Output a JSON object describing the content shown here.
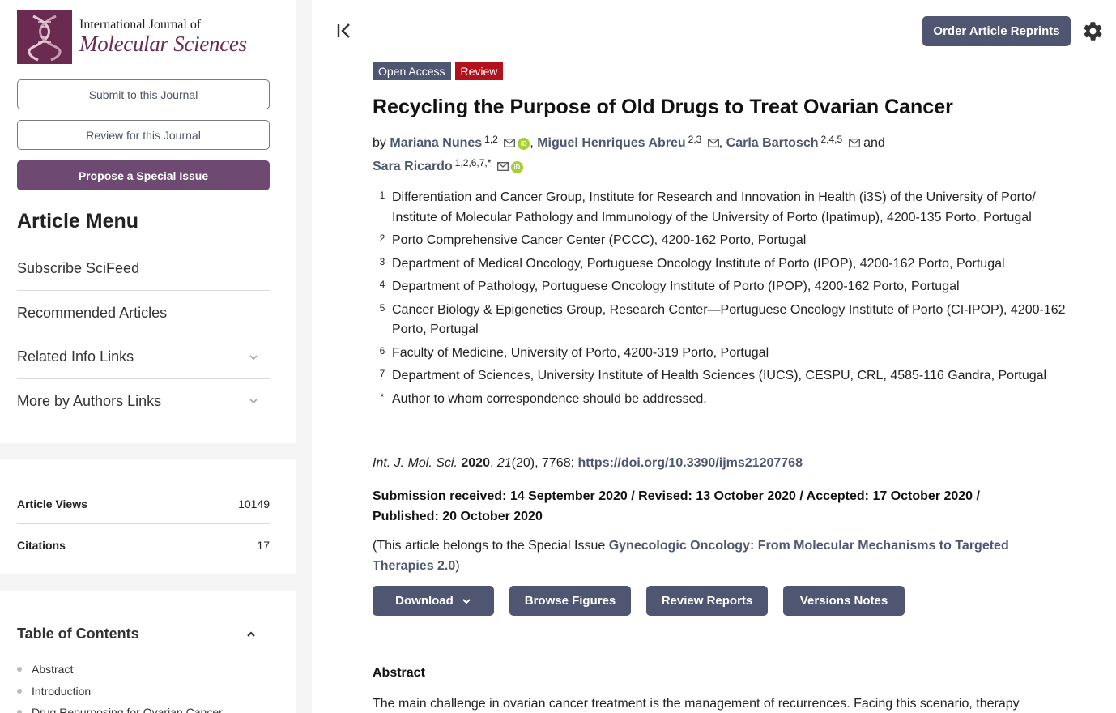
{
  "sidebar": {
    "logo": {
      "line1": "International Journal of",
      "line2": "Molecular Sciences",
      "brand_color": "#6b2a4f"
    },
    "submit_label": "Submit to this Journal",
    "review_label": "Review for this Journal",
    "propose_label": "Propose a Special Issue",
    "menu_title": "Article Menu",
    "menu_items": [
      {
        "label": "Subscribe SciFeed",
        "expandable": false
      },
      {
        "label": "Recommended Articles",
        "expandable": false
      },
      {
        "label": "Related Info Links",
        "expandable": true
      },
      {
        "label": "More by Authors Links",
        "expandable": true
      }
    ],
    "stats": [
      {
        "label": "Article Views",
        "value": "10149"
      },
      {
        "label": "Citations",
        "value": "17"
      }
    ],
    "toc": {
      "title": "Table of Contents",
      "items": [
        "Abstract",
        "Introduction",
        "Drug Repurposing for Ovarian Cancer"
      ]
    }
  },
  "header": {
    "reprints_label": "Order Article Reprints"
  },
  "article": {
    "badges": [
      "Open Access",
      "Review"
    ],
    "title": "Recycling the Purpose of Old Drugs to Treat Ovarian Cancer",
    "by": "by",
    "and": "and",
    "authors": [
      {
        "name": "Mariana Nunes",
        "sup": "1,2",
        "orcid": true
      },
      {
        "name": "Miguel Henriques Abreu",
        "sup": "2,3",
        "orcid": false
      },
      {
        "name": "Carla Bartosch",
        "sup": "2,4,5",
        "orcid": false
      },
      {
        "name": "Sara Ricardo",
        "sup": "1,2,6,7,*",
        "orcid": true
      }
    ],
    "affiliations": [
      {
        "num": "1",
        "text": "Differentiation and Cancer Group, Institute for Research and Innovation in Health (i3S) of the University of Porto/ Institute of Molecular Pathology and Immunology of the University of Porto (Ipatimup), 4200-135 Porto, Portugal"
      },
      {
        "num": "2",
        "text": "Porto Comprehensive Cancer Center (PCCC), 4200-162 Porto, Portugal"
      },
      {
        "num": "3",
        "text": "Department of Medical Oncology, Portuguese Oncology Institute of Porto (IPOP), 4200-162 Porto, Portugal"
      },
      {
        "num": "4",
        "text": "Department of Pathology, Portuguese Oncology Institute of Porto (IPOP), 4200-162 Porto, Portugal"
      },
      {
        "num": "5",
        "text": "Cancer Biology & Epigenetics Group, Research Center—Portuguese Oncology Institute of Porto (CI-IPOP), 4200-162 Porto, Portugal"
      },
      {
        "num": "6",
        "text": "Faculty of Medicine, University of Porto, 4200-319 Porto, Portugal"
      },
      {
        "num": "7",
        "text": "Department of Sciences, University Institute of Health Sciences (IUCS), CESPU, CRL, 4585-116 Gandra, Portugal"
      },
      {
        "num": "*",
        "text": "Author to whom correspondence should be addressed."
      }
    ],
    "citation": {
      "journal": "Int. J. Mol. Sci.",
      "year": "2020",
      "volume": "21",
      "issue_pages": "(20), 7768;",
      "doi": "https://doi.org/10.3390/ijms21207768"
    },
    "dates": "Submission received: 14 September 2020 / Revised: 13 October 2020 / Accepted: 17 October 2020 / Published: 20 October 2020",
    "special_issue": {
      "prefix": "(This article belongs to the Special Issue ",
      "link": "Gynecologic Oncology: From Molecular Mechanisms to Targeted Therapies 2.0",
      "suffix": ")"
    },
    "actions": {
      "download": "Download",
      "browse_figures": "Browse Figures",
      "review_reports": "Review Reports",
      "versions_notes": "Versions Notes"
    },
    "abstract_title": "Abstract",
    "abstract_text": "The main challenge in ovarian cancer treatment is the management of recurrences. Facing this scenario, therapy"
  },
  "colors": {
    "accent": "#4f5671",
    "review_badge": "#b3121c",
    "propose_button": "#6e4a72",
    "orcid": "#a6ce39"
  }
}
